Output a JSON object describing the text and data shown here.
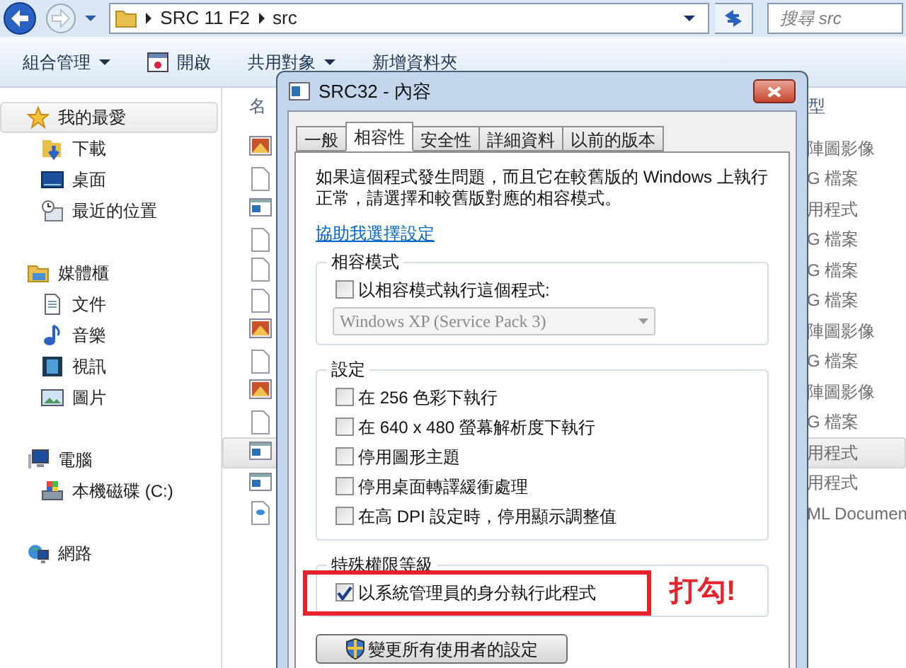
{
  "address_bar": {
    "breadcrumbs": [
      "SRC 11 F2",
      "src"
    ],
    "search": {
      "placeholder": "搜尋 src"
    }
  },
  "toolbar": [
    {
      "label": "組合管理",
      "kind": "menu"
    },
    {
      "label": "開啟",
      "kind": "open"
    },
    {
      "label": "共用對象",
      "kind": "menu"
    },
    {
      "label": "新增資料夾",
      "kind": "plain"
    }
  ],
  "sidebar": [
    {
      "label": "我的最愛",
      "kind": "star",
      "selected": true,
      "children": [
        {
          "label": "下載",
          "kind": "download",
          "selected": false
        },
        {
          "label": "桌面",
          "kind": "desktop",
          "selected": false
        },
        {
          "label": "最近的位置",
          "kind": "recent",
          "selected": false
        }
      ]
    },
    {
      "label": "媒體櫃",
      "kind": "library",
      "selected": false,
      "children": [
        {
          "label": "文件",
          "kind": "document",
          "selected": false
        },
        {
          "label": "音樂",
          "kind": "music",
          "selected": false
        },
        {
          "label": "視訊",
          "kind": "video",
          "selected": false
        },
        {
          "label": "圖片",
          "kind": "picture",
          "selected": false
        }
      ]
    },
    {
      "label": "電腦",
      "kind": "computer",
      "selected": false,
      "children": [
        {
          "label": "本機磁碟 (C:)",
          "kind": "drive",
          "selected": false
        }
      ]
    },
    {
      "label": "網路",
      "kind": "network",
      "selected": false
    }
  ],
  "file_list": {
    "columns": [
      "名",
      "型"
    ],
    "rows": [
      {
        "kind": "image",
        "type": "陣圖影像",
        "selected": false
      },
      {
        "kind": "file",
        "type": "G 檔案",
        "selected": false
      },
      {
        "kind": "app",
        "type": "用程式",
        "selected": false
      },
      {
        "kind": "file",
        "type": "G 檔案",
        "selected": false
      },
      {
        "kind": "file",
        "type": "G 檔案",
        "selected": false
      },
      {
        "kind": "file",
        "type": "G 檔案",
        "selected": false
      },
      {
        "kind": "image",
        "type": "陣圖影像",
        "selected": false
      },
      {
        "kind": "file",
        "type": "G 檔案",
        "selected": false
      },
      {
        "kind": "image",
        "type": "陣圖影像",
        "selected": false
      },
      {
        "kind": "file",
        "type": "G 檔案",
        "selected": false
      },
      {
        "kind": "app",
        "type": "用程式",
        "selected": true
      },
      {
        "kind": "app",
        "type": "用程式",
        "selected": false
      },
      {
        "kind": "html",
        "type": "ML Documen",
        "selected": false
      }
    ]
  },
  "dialog": {
    "title": "SRC32 - 內容",
    "tabs": [
      {
        "label": "一般",
        "selected": false
      },
      {
        "label": "相容性",
        "selected": true
      },
      {
        "label": "安全性",
        "selected": false
      },
      {
        "label": "詳細資料",
        "selected": false
      },
      {
        "label": "以前的版本",
        "selected": false
      }
    ],
    "description": "如果這個程式發生問題，而且它在較舊版的 Windows 上執行正常，請選擇和較舊版對應的相容模式。",
    "help_link": "協助我選擇設定",
    "groups": [
      {
        "title": "相容模式",
        "items": [
          {
            "kind": "checkbox",
            "label": "以相容模式執行這個程式:",
            "checked": false
          },
          {
            "kind": "dropdown",
            "value": "Windows XP (Service Pack 3)",
            "disabled": true
          }
        ]
      },
      {
        "title": "設定",
        "items": [
          {
            "kind": "checkbox",
            "label": "在 256 色彩下執行",
            "checked": false
          },
          {
            "kind": "checkbox",
            "label": "在 640 x 480 螢幕解析度下執行",
            "checked": false
          },
          {
            "kind": "checkbox",
            "label": "停用圖形主題",
            "checked": false
          },
          {
            "kind": "checkbox",
            "label": "停用桌面轉譯緩衝處理",
            "checked": false
          },
          {
            "kind": "checkbox",
            "label": "在高 DPI 設定時，停用顯示調整值",
            "checked": false
          }
        ]
      },
      {
        "title": "特殊權限等級",
        "items": [
          {
            "kind": "checkbox",
            "label": "以系統管理員的身分執行此程式",
            "checked": true,
            "annotation": "打勾!"
          }
        ]
      }
    ],
    "button": "變更所有使用者的設定"
  }
}
